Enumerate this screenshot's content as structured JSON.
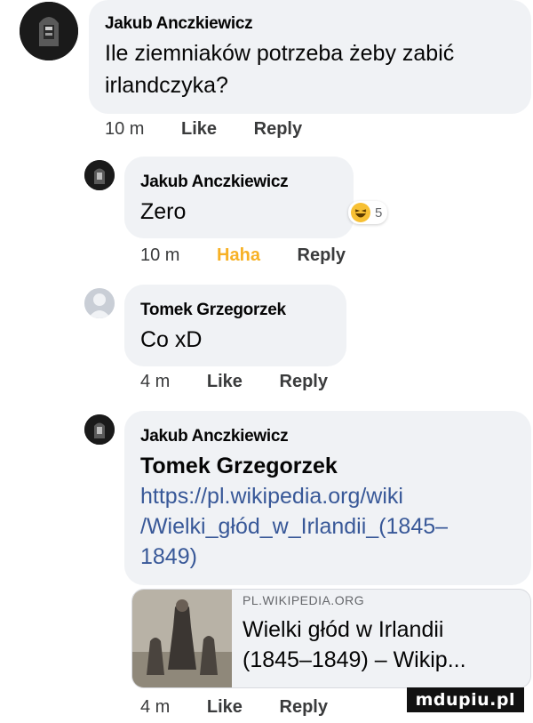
{
  "comments": [
    {
      "author": "Jakub Anczkiewicz",
      "lines": [
        "Ile ziemniaków potrzeba żeby zabić",
        "irlandczyka?"
      ],
      "time": "10 m",
      "action1": "Like",
      "action2": "Reply"
    },
    {
      "author": "Jakub Anczkiewicz",
      "lines": [
        "Zero"
      ],
      "reaction_count": "5",
      "reaction_icon": "laughing-emoji-icon",
      "time": "10 m",
      "action1": "Haha",
      "action2": "Reply"
    },
    {
      "author": "Tomek Grzegorzek",
      "lines": [
        "Co xD"
      ],
      "time": "4 m",
      "action1": "Like",
      "action2": "Reply"
    },
    {
      "author": "Jakub Anczkiewicz",
      "mention": "Tomek Grzegorzek",
      "lines": [
        "https://pl.wikipedia.org/wiki",
        "/Wielki_głód_w_Irlandii_(1845–",
        "1849)"
      ],
      "link_preview": {
        "domain": "PL.WIKIPEDIA.ORG",
        "title_lines": [
          "Wielki głód w Irlandii",
          "(1845–1849) – Wikip..."
        ]
      },
      "time": "4 m",
      "action1": "Like",
      "action2": "Reply"
    }
  ],
  "watermark": "mdupiu.pl",
  "colors": {
    "bubble": "#f0f2f5",
    "link": "#385898",
    "haha": "#f7b125",
    "meta": "#3a3b3c"
  }
}
